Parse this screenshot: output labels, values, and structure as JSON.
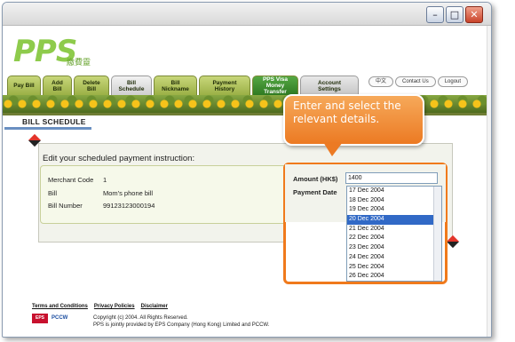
{
  "window": {
    "controls": [
      "minimize",
      "maximize",
      "close"
    ]
  },
  "logo": {
    "text": "PPS",
    "subtext": "繳費靈"
  },
  "tabs": [
    {
      "label": "Pay Bill"
    },
    {
      "label": "Add Bill"
    },
    {
      "label": "Delete Bill"
    },
    {
      "label": "Bill Schedule"
    },
    {
      "label": "Bill Nickname"
    },
    {
      "label": "Payment History"
    },
    {
      "label": "PPS Visa Money Transfer"
    },
    {
      "label": "Account Settings"
    }
  ],
  "toplinks": [
    {
      "label": "中文"
    },
    {
      "label": "Contact Us"
    },
    {
      "label": "Logout"
    }
  ],
  "page": {
    "title": "BILL SCHEDULE"
  },
  "panel": {
    "title": "Edit your scheduled payment instruction:",
    "merchant_code_label": "Merchant Code",
    "merchant_code_value": "1",
    "bill_label": "Bill",
    "bill_value": "Mom's phone bill",
    "bill_number_label": "Bill Number",
    "bill_number_value": "99123123000194"
  },
  "form": {
    "amount_label": "Amount (HK$)",
    "amount_value": "1400",
    "payment_date_label": "Payment Date",
    "dates": [
      "17 Dec 2004",
      "18 Dec 2004",
      "19 Dec 2004",
      "20 Dec 2004",
      "21 Dec 2004",
      "22 Dec 2004",
      "23 Dec 2004",
      "24 Dec 2004",
      "25 Dec 2004",
      "26 Dec 2004"
    ],
    "selected_date": "20 Dec 2004"
  },
  "callout": {
    "text": "Enter and select the relevant details."
  },
  "footer": {
    "links": [
      "Terms and Conditions",
      "Privacy Policies",
      "Disclaimer"
    ],
    "copyright": "Copyright (c) 2004. All Rights Reserved.",
    "provided_by": "PPS is jointly provided by EPS Company (Hong Kong) Limited and PCCW.",
    "eps_logo": "EPS",
    "pccw_logo": "PCCW"
  },
  "colors": {
    "accent": "#ec7a23",
    "selection": "#3169c6",
    "tab_green": "#9bb046"
  }
}
